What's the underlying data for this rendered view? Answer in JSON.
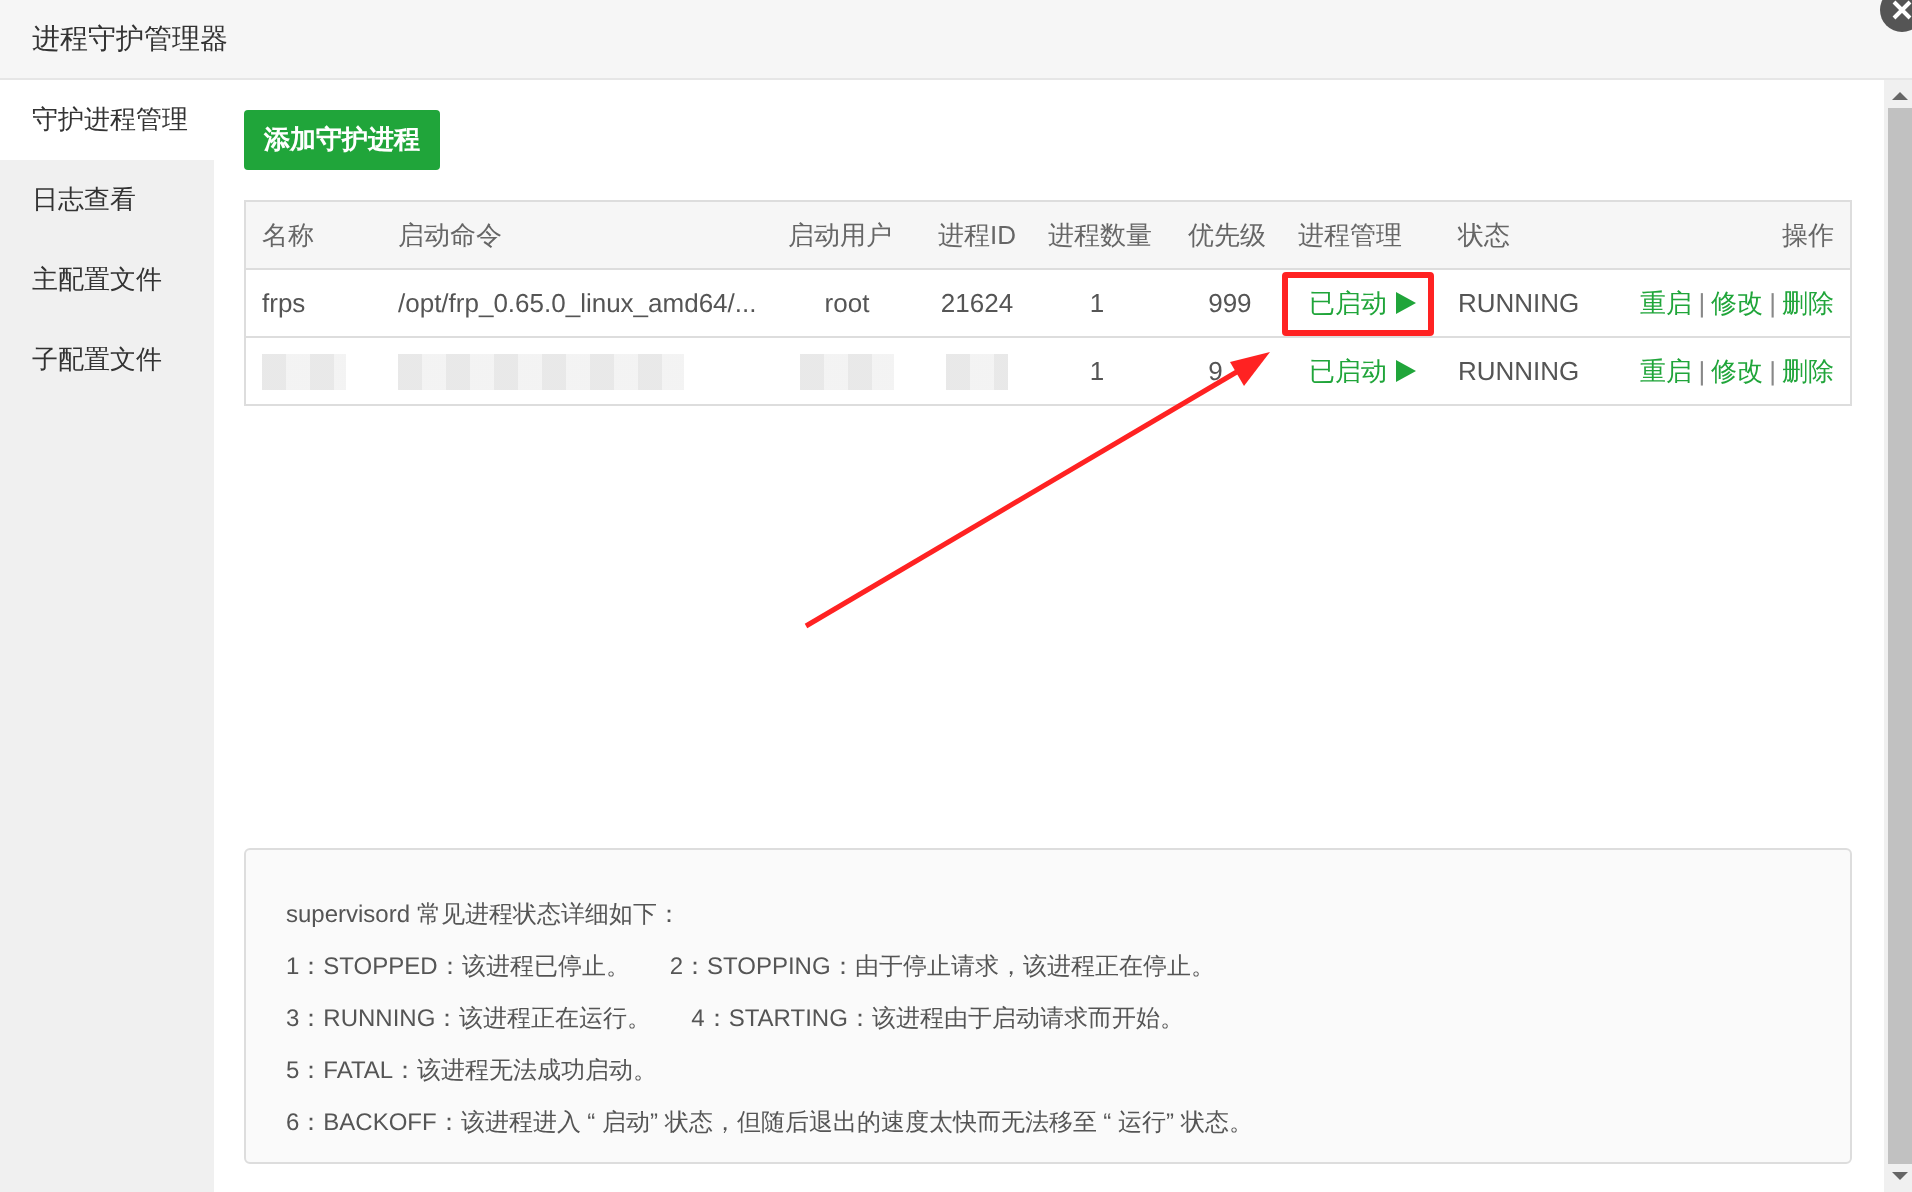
{
  "window": {
    "title": "进程守护管理器"
  },
  "sidebar": {
    "items": [
      {
        "label": "守护进程管理",
        "selected": true
      },
      {
        "label": "日志查看",
        "selected": false
      },
      {
        "label": "主配置文件",
        "selected": false
      },
      {
        "label": "子配置文件",
        "selected": false
      }
    ]
  },
  "add_button": "添加守护进程",
  "table": {
    "columns": [
      "名称",
      "启动命令",
      "启动用户",
      "进程ID",
      "进程数量",
      "优先级",
      "进程管理",
      "状态",
      "操作"
    ],
    "rows": [
      {
        "name": "frps",
        "command": "/opt/frp_0.65.0_linux_amd64/...",
        "user": "root",
        "pid": "21624",
        "count": "1",
        "priority": "999",
        "management": {
          "text": "已启动",
          "running": true,
          "highlighted": true
        },
        "status": "RUNNING",
        "actions": [
          {
            "kind": "link",
            "text": "重启"
          },
          {
            "kind": "separator",
            "text": "|"
          },
          {
            "kind": "link",
            "text": "修改"
          },
          {
            "kind": "separator",
            "text": "|"
          },
          {
            "kind": "link",
            "text": "删除"
          }
        ]
      },
      {
        "count": "1",
        "priority": "9",
        "management": {
          "text": "已启动",
          "running": true,
          "highlighted": false
        },
        "status": "RUNNING",
        "actions": [
          {
            "kind": "link",
            "text": "重启"
          },
          {
            "kind": "separator",
            "text": "|"
          },
          {
            "kind": "link",
            "text": "修改"
          },
          {
            "kind": "separator",
            "text": "|"
          },
          {
            "kind": "link",
            "text": "删除"
          }
        ]
      }
    ]
  },
  "info": {
    "lines": [
      [
        "supervisord 常见进程状态详细如下："
      ],
      [
        "1：STOPPED：该进程已停止。",
        "2：STOPPING：由于停止请求，该进程正在停止。"
      ],
      [
        "3：RUNNING：该进程正在运行。",
        "4：STARTING：该进程由于启动请求而开始。"
      ],
      [
        "5：FATAL：该进程无法成功启动。"
      ],
      [
        "6：BACKOFF：该进程进入 “ 启动” 状态，但随后退出的速度太快而无法移至 “ 运行” 状态。"
      ]
    ]
  }
}
